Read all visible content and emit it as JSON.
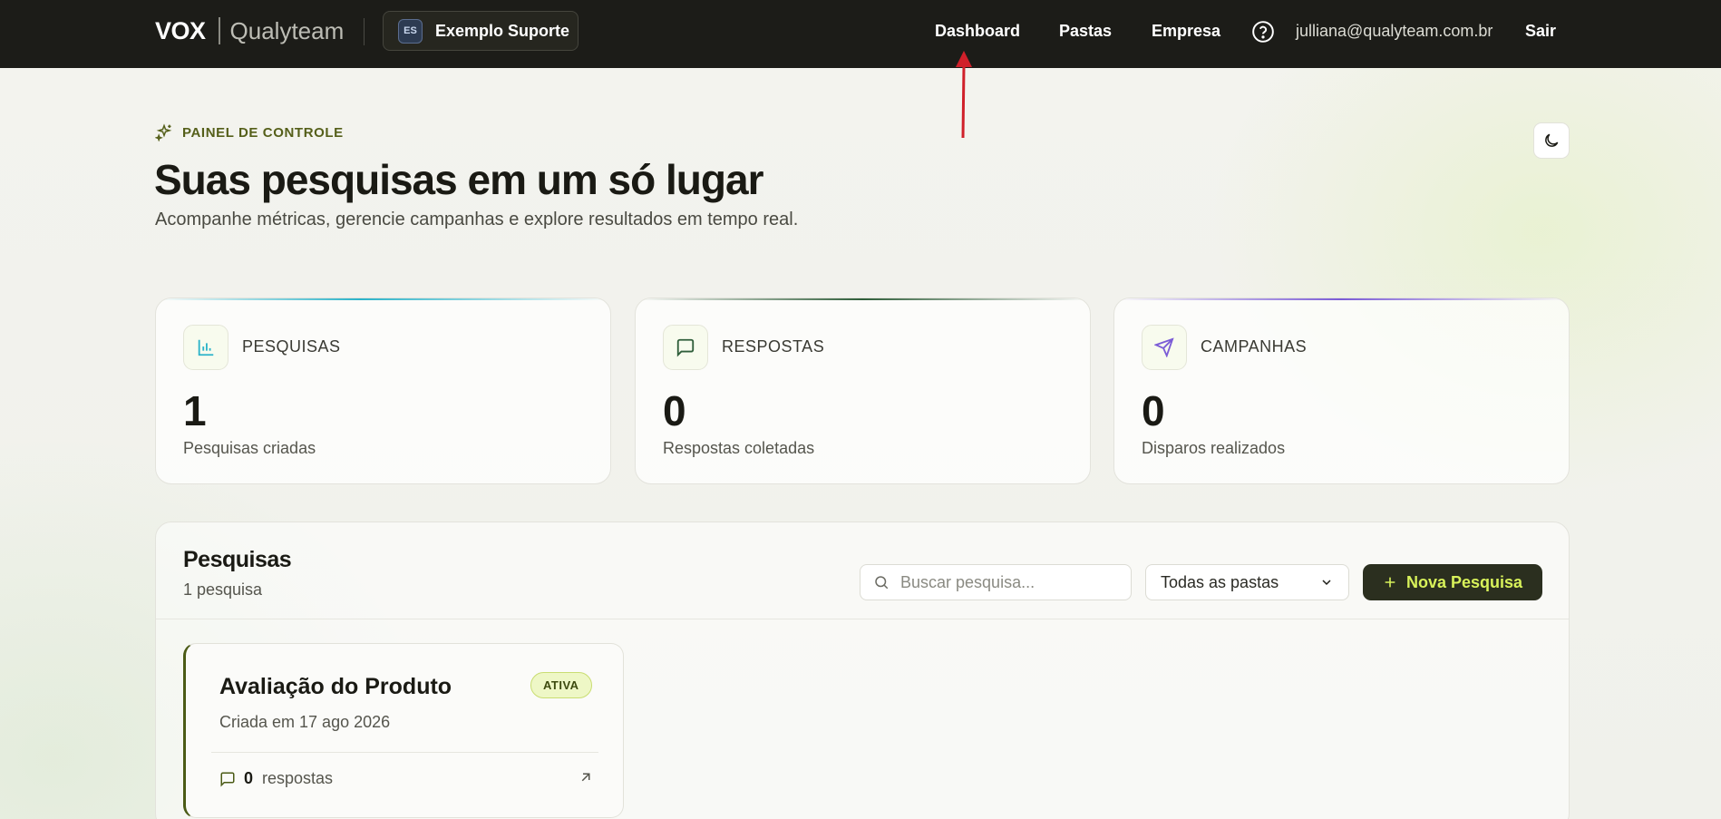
{
  "topbar": {
    "brand_vox": "VOX",
    "brand_name": "Qualyteam",
    "org_badge": "ES",
    "org_name": "Exemplo Suporte",
    "nav": [
      "Dashboard",
      "Pastas",
      "Empresa"
    ],
    "help_icon": "question-circle-icon",
    "user_email": "julliana@qualyteam.com.br",
    "logout": "Sair"
  },
  "header": {
    "eyebrow": "PAINEL DE CONTROLE",
    "eyebrow_icon": "sparkles-icon",
    "title": "Suas pesquisas em um só lugar",
    "subtitle": "Acompanhe métricas, gerencie campanhas e explore resultados em tempo real.",
    "theme_icon": "moon-icon"
  },
  "stats": [
    {
      "label": "PESQUISAS",
      "value": "1",
      "desc": "Pesquisas criadas",
      "icon": "bar-chart-icon",
      "accent": "#2bb3c9"
    },
    {
      "label": "RESPOSTAS",
      "value": "0",
      "desc": "Respostas coletadas",
      "icon": "message-square-icon",
      "accent": "#2f5e3a"
    },
    {
      "label": "CAMPANHAS",
      "value": "0",
      "desc": "Disparos realizados",
      "icon": "send-icon",
      "accent": "#7b5cd6"
    }
  ],
  "surveys": {
    "title": "Pesquisas",
    "count": "1 pesquisa",
    "search_placeholder": "Buscar pesquisa...",
    "folder_filter": "Todas as pastas",
    "new_button": "Nova Pesquisa",
    "items": [
      {
        "title": "Avaliação do Produto",
        "status": "ATIVA",
        "created": "Criada em 17 ago 2026",
        "responses": "0",
        "responses_label": "respostas"
      }
    ]
  },
  "colors": {
    "topbar": "#1c1c18",
    "accent_lime": "#d8f25a",
    "annotation_arrow": "#d0202a"
  }
}
